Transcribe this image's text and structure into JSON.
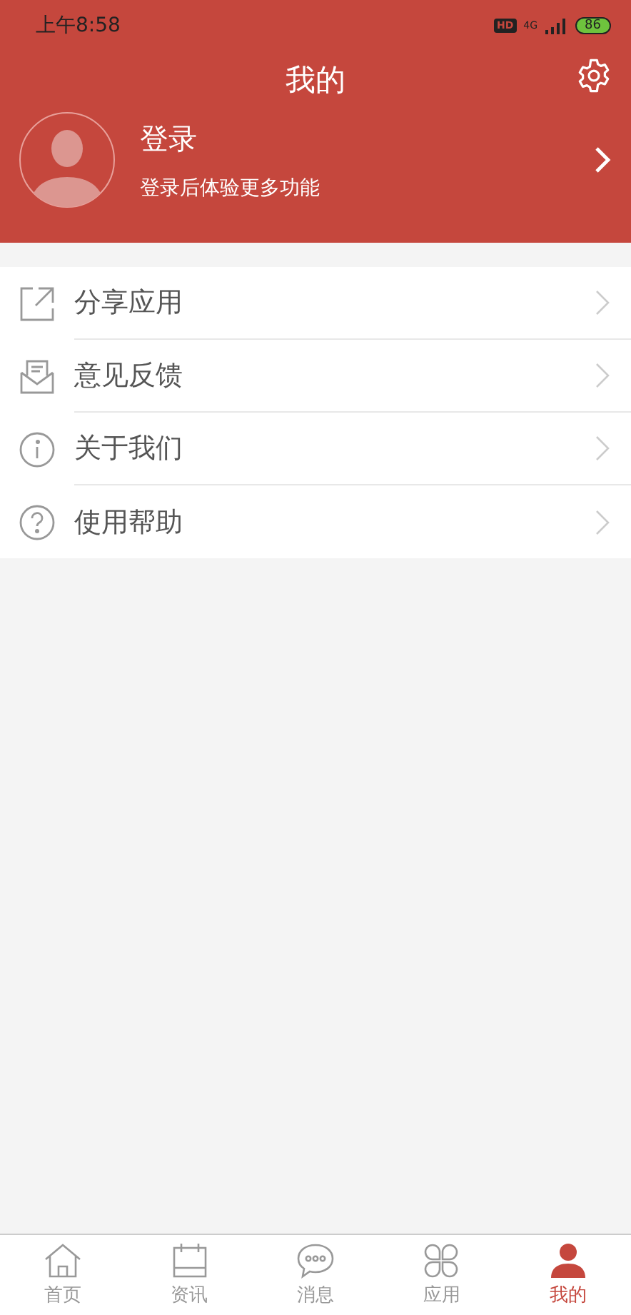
{
  "status_bar": {
    "time": "上午8:58",
    "hd": "HD",
    "network": "4G",
    "battery": "86"
  },
  "header": {
    "title": "我的"
  },
  "profile": {
    "name": "登录",
    "hint": "登录后体验更多功能"
  },
  "menu": [
    {
      "kind": "share",
      "label": "分享应用"
    },
    {
      "kind": "feedback",
      "label": "意见反馈"
    },
    {
      "kind": "about",
      "label": "关于我们"
    },
    {
      "kind": "help",
      "label": "使用帮助"
    }
  ],
  "tabs": [
    {
      "kind": "home",
      "label": "首页",
      "selected": false
    },
    {
      "kind": "news",
      "label": "资讯",
      "selected": false
    },
    {
      "kind": "messages",
      "label": "消息",
      "selected": false
    },
    {
      "kind": "apps",
      "label": "应用",
      "selected": false
    },
    {
      "kind": "me",
      "label": "我的",
      "selected": true
    }
  ]
}
